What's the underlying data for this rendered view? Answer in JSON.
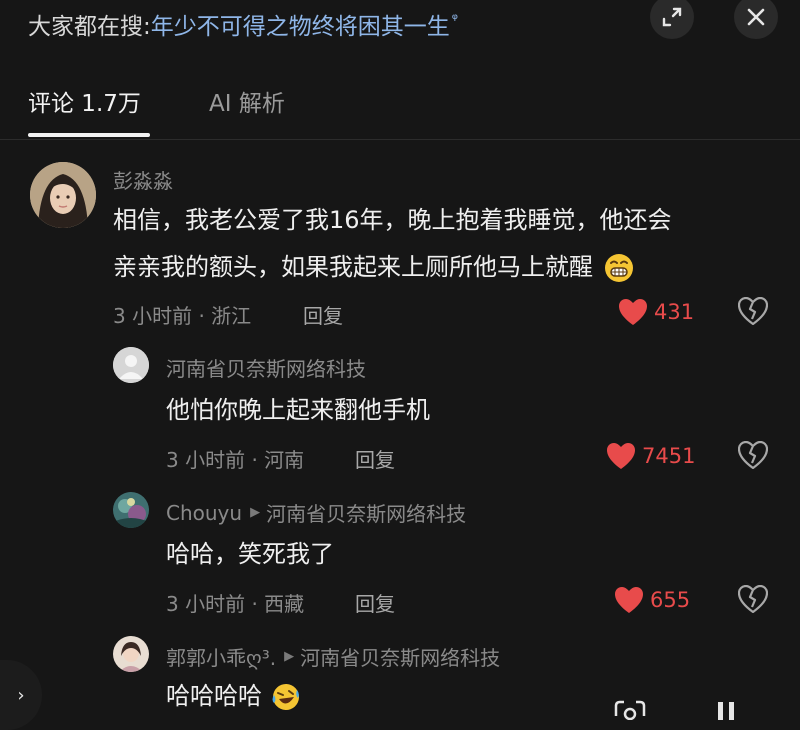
{
  "header": {
    "search_prefix": "大家都在搜:",
    "search_query": "年少不可得之物终将困其一生",
    "search_mark": "ᵠ"
  },
  "tabs": [
    {
      "label": "评论 1.7万"
    },
    {
      "label": "AI 解析"
    }
  ],
  "comments": [
    {
      "username": "彭淼淼",
      "lines": [
        "相信，我老公爱了我16年，晚上抱着我睡觉，他还会",
        "亲亲我的额头，如果我起来上厕所他马上就醒"
      ],
      "emoji": "grinning-face",
      "meta": "3 小时前 · 浙江",
      "reply": "回复",
      "likes": "431"
    },
    {
      "username": "河南省贝奈斯网络科技",
      "lines": [
        "他怕你晚上起来翻他手机"
      ],
      "meta": "3 小时前 · 河南",
      "reply": "回复",
      "likes": "7451"
    },
    {
      "username": "Chouyu",
      "reply_to": "河南省贝奈斯网络科技",
      "lines": [
        "哈哈，笑死我了"
      ],
      "meta": "3 小时前 · 西藏",
      "reply": "回复",
      "likes": "655"
    },
    {
      "username": "郭郭小乖ღ³.",
      "reply_to": "河南省贝奈斯网络科技",
      "lines": [
        "哈哈哈哈"
      ],
      "emoji": "laughing-crying-face"
    }
  ],
  "colors": {
    "background": "#161616",
    "link_blue": "#8fb6e8",
    "like_red": "#e84b4b",
    "muted": "#8a8a8a"
  }
}
